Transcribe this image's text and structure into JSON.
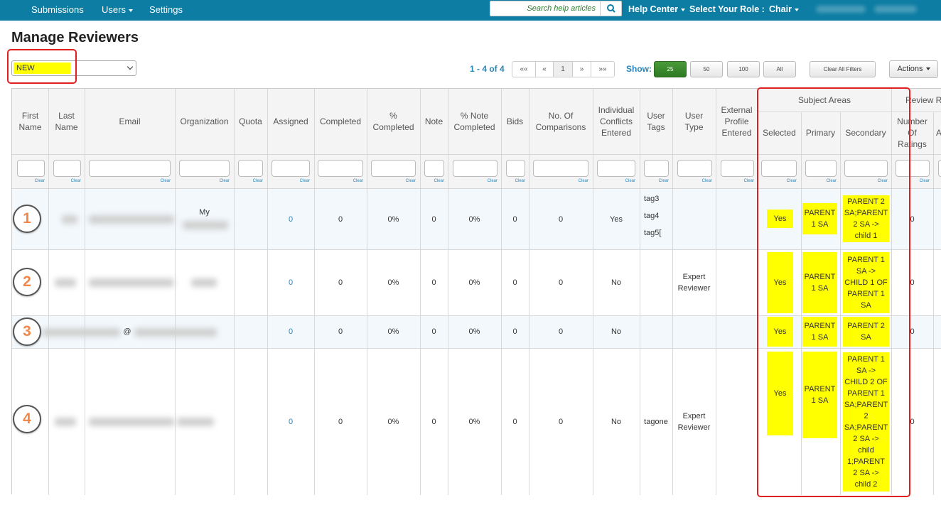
{
  "navbar": {
    "submissions": "Submissions",
    "users": "Users",
    "settings": "Settings",
    "search_placeholder": "Search help articles",
    "help_center": "Help Center",
    "role_label": "Select Your Role :",
    "role_value": "Chair"
  },
  "page": {
    "title": "Manage Reviewers"
  },
  "filter": {
    "selected": "NEW"
  },
  "pager": {
    "info": "1 - 4 of 4",
    "first": "««",
    "prev": "«",
    "page": "1",
    "next": "»",
    "last": "»»",
    "show_label": "Show:",
    "sizes": [
      "25",
      "50",
      "100",
      "All"
    ],
    "clear_filters": "Clear All Filters",
    "actions": "Actions"
  },
  "table": {
    "group_headers": {
      "subject_areas": "Subject Areas",
      "review": "Review R"
    },
    "columns": {
      "first_name": "First Name",
      "last_name": "Last Name",
      "email": "Email",
      "organization": "Organization",
      "quota": "Quota",
      "assigned": "Assigned",
      "completed": "Completed",
      "pct_completed": "% Completed",
      "note": "Note",
      "pct_note_completed": "% Note Completed",
      "bids": "Bids",
      "num_comparisons": "No. Of Comparisons",
      "individual_conflicts": "Individual Conflicts Entered",
      "user_tags": "User Tags",
      "user_type": "User Type",
      "external_profile": "External Profile Entered",
      "selected": "Selected",
      "primary": "Primary",
      "secondary": "Secondary",
      "num_ratings": "Number Of Ratings",
      "cut": "A"
    },
    "clear_label": "Clear",
    "rows": [
      {
        "number": "1",
        "org_visible": "My",
        "assigned": "0",
        "completed": "0",
        "pct_completed": "0%",
        "note": "0",
        "pct_note": "0%",
        "bids": "0",
        "comparisons": "0",
        "conflicts": "Yes",
        "tags": [
          "tag3",
          "tag4",
          "tag5["
        ],
        "user_type": "",
        "selected": "Yes",
        "primary": "PARENT 1 SA",
        "secondary": "PARENT 2 SA;PARENT 2 SA -> child 1",
        "ratings": "0"
      },
      {
        "number": "2",
        "assigned": "0",
        "completed": "0",
        "pct_completed": "0%",
        "note": "0",
        "pct_note": "0%",
        "bids": "0",
        "comparisons": "0",
        "conflicts": "No",
        "user_type": "Expert Reviewer",
        "selected": "Yes",
        "primary": "PARENT 1 SA",
        "secondary": "PARENT 1 SA -> CHILD 1 OF PARENT 1 SA",
        "ratings": "0"
      },
      {
        "number": "3",
        "email_visible": "@",
        "assigned": "0",
        "completed": "0",
        "pct_completed": "0%",
        "note": "0",
        "pct_note": "0%",
        "bids": "0",
        "comparisons": "0",
        "conflicts": "No",
        "user_type": "",
        "selected": "Yes",
        "primary": "PARENT 1 SA",
        "secondary": "PARENT 2 SA",
        "ratings": "0"
      },
      {
        "number": "4",
        "assigned": "0",
        "completed": "0",
        "pct_completed": "0%",
        "note": "0",
        "pct_note": "0%",
        "bids": "0",
        "comparisons": "0",
        "conflicts": "No",
        "tags": [
          "tagone"
        ],
        "user_type": "Expert Reviewer",
        "selected": "Yes",
        "primary": "PARENT 1 SA",
        "secondary": "PARENT 1 SA -> CHILD 2 OF PARENT 1 SA;PARENT 2 SA;PARENT 2 SA -> child 1;PARENT 2 SA -> child 2",
        "ratings": "0"
      }
    ]
  },
  "colors": {
    "navbar": "#0d7da3",
    "highlight": "#ffff00",
    "annotation": "#e02020",
    "step_number": "#f2874a",
    "link": "#2a86b8"
  }
}
